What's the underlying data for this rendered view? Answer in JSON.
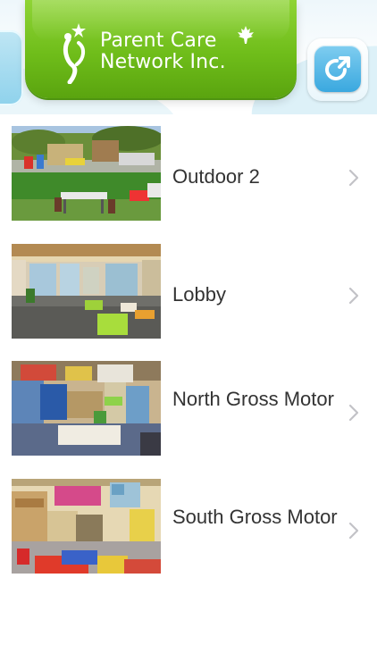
{
  "header": {
    "brand_line1": "Parent Care",
    "brand_line2": "Network Inc.",
    "icons": {
      "logo": "parent-child-figure-icon",
      "maple": "maple-leaf-icon",
      "share": "share-icon"
    },
    "colors": {
      "banner": "#6fbd1a",
      "share": "#3aa8df"
    }
  },
  "rooms": [
    {
      "title": "Outdoor 2",
      "image": "playground-photo"
    },
    {
      "title": "Lobby",
      "image": "lobby-photo"
    },
    {
      "title": "North Gross Motor",
      "image": "north-gross-motor-photo"
    },
    {
      "title": "South Gross Motor",
      "image": "south-gross-motor-photo"
    }
  ]
}
